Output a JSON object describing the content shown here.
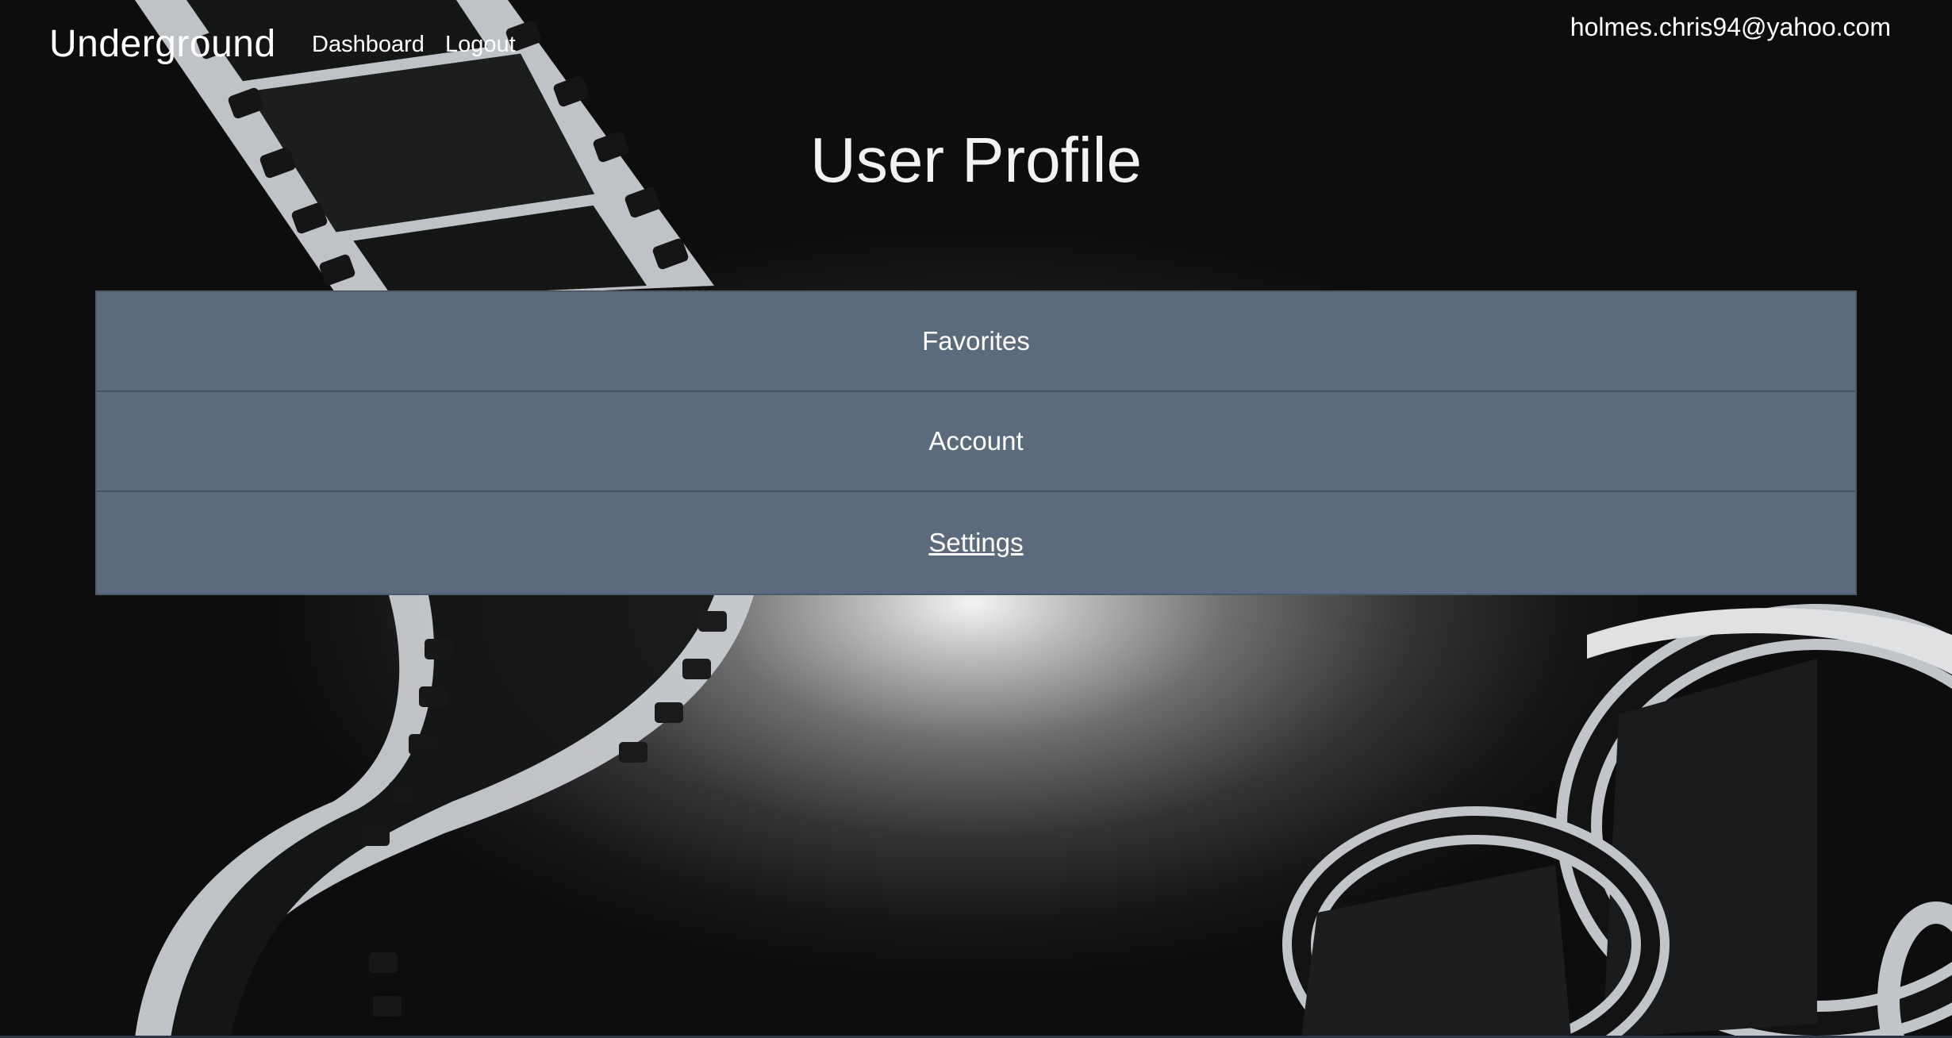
{
  "navbar": {
    "brand": "Underground",
    "links": [
      {
        "label": "Dashboard"
      },
      {
        "label": "Logout"
      }
    ],
    "user_email": "holmes.chris94@yahoo.com"
  },
  "page": {
    "title": "User Profile"
  },
  "menu": {
    "items": [
      {
        "label": "Favorites"
      },
      {
        "label": "Account"
      },
      {
        "label": "Settings",
        "active": true
      }
    ]
  },
  "colors": {
    "menu_background": "#5c6b7b",
    "menu_border": "#46525f",
    "text": "#ffffff"
  },
  "background": {
    "image": "film-strip-icon"
  }
}
